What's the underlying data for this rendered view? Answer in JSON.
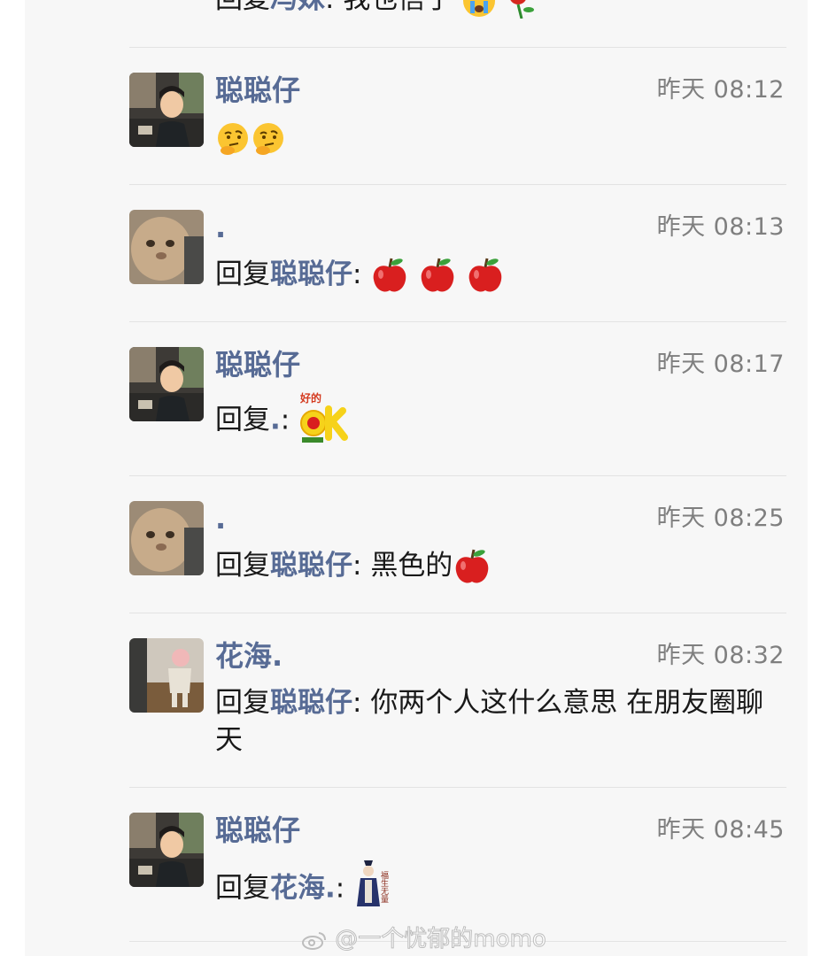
{
  "comments": [
    {
      "name": "",
      "time": "",
      "reply_prefix": "回复",
      "reply_target": "冯妹",
      "colon": ":",
      "text": "我也信了"
    },
    {
      "name": "聪聪仔",
      "time": "昨天 08:12",
      "content": ""
    },
    {
      "name": ".",
      "time": "昨天 08:13",
      "reply_prefix": "回复",
      "reply_target": "聪聪仔",
      "colon": ":",
      "text": ""
    },
    {
      "name": "聪聪仔",
      "time": "昨天 08:17",
      "reply_prefix": "回复",
      "reply_target": ".",
      "colon": ":",
      "text": ""
    },
    {
      "name": ".",
      "time": "昨天 08:25",
      "reply_prefix": "回复",
      "reply_target": "聪聪仔",
      "colon": ":",
      "text": "黑色的"
    },
    {
      "name": "花海.",
      "time": "昨天 08:32",
      "reply_prefix": "回复",
      "reply_target": "聪聪仔",
      "colon": ":",
      "text": "你两个人这什么意思 在朋友圈聊天"
    },
    {
      "name": "聪聪仔",
      "time": "昨天 08:45",
      "reply_prefix": "回复",
      "reply_target": "花海.",
      "colon": ":",
      "text": ""
    }
  ],
  "stickers": {
    "ok_sticker_text_top": "好的",
    "ok_sticker_text": "ok",
    "fortune_sticker_text": "福生无量"
  },
  "watermark": "@一个忧郁的momo",
  "icons": {
    "thinking_face": "thinking-face-emoji",
    "apple": "red-apple-emoji",
    "crying_face": "crying-face-emoji",
    "rose": "rose-emoji"
  },
  "colors": {
    "name_blue": "#576b95",
    "time_gray": "#7f7f7f",
    "panel_bg": "#f7f7f7"
  }
}
